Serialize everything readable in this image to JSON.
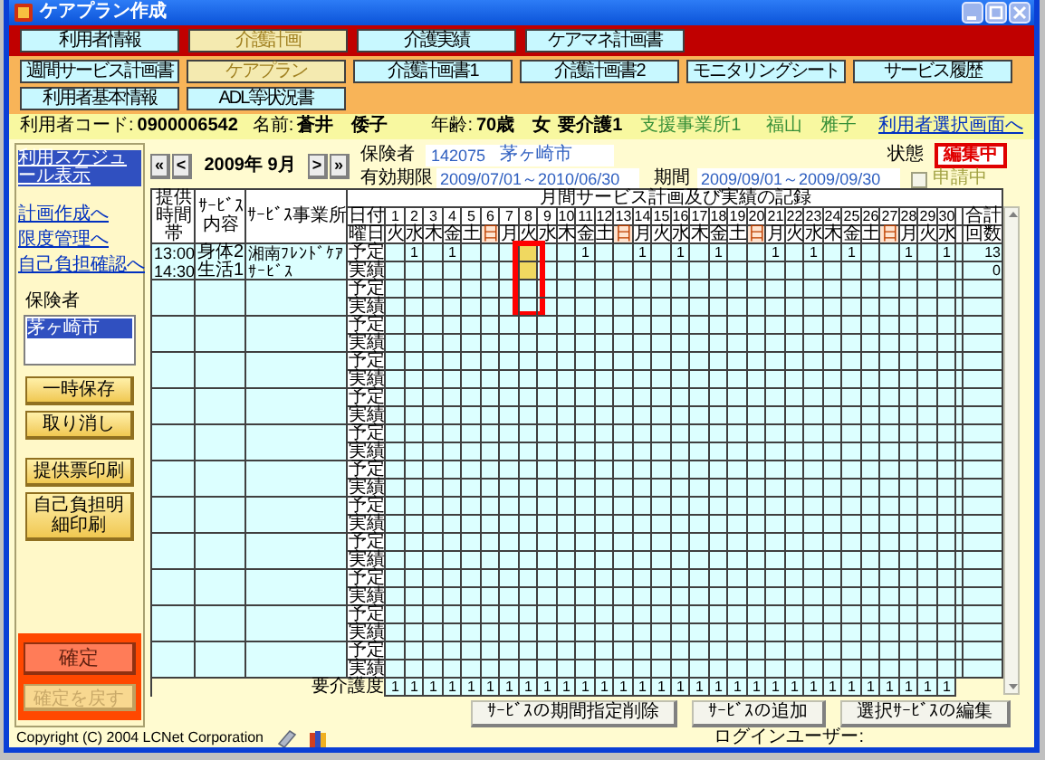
{
  "window": {
    "title": "ケアプラン作成"
  },
  "main_tabs": [
    {
      "label": "利用者情報",
      "selected": false
    },
    {
      "label": "介護計画",
      "selected": true
    },
    {
      "label": "介護実績",
      "selected": false
    },
    {
      "label": "ケアマネ計画書",
      "selected": false
    }
  ],
  "sub_tabs": [
    {
      "label": "週間サービス計画書",
      "selected": false
    },
    {
      "label": "ケアプラン",
      "selected": true
    },
    {
      "label": "介護計画書1",
      "selected": false
    },
    {
      "label": "介護計画書2",
      "selected": false
    },
    {
      "label": "モニタリングシート",
      "selected": false
    },
    {
      "label": "サービス履歴",
      "selected": false
    },
    {
      "label": "利用者基本情報",
      "selected": false
    },
    {
      "label": "ADL等状況書",
      "selected": false
    }
  ],
  "user_info": {
    "code_label": "利用者コード:",
    "code": "0900006542",
    "name_label": "名前:",
    "name": "蒼井　倭子",
    "age_label": "年齢:",
    "age": "70歳",
    "sex": "女",
    "care_level": "要介護1",
    "office": "支援事業所1",
    "manager": "福山　雅子",
    "select_link": "利用者選択画面へ"
  },
  "sidebar": {
    "schedule_link": {
      "label": "利用スケジュール表示",
      "selected": true
    },
    "links": [
      "計画作成へ",
      "限度管理へ",
      "自己負担確認へ"
    ],
    "insurer_label": "保険者",
    "insurers": [
      {
        "label": "茅ヶ崎市",
        "selected": true
      }
    ],
    "buttons": [
      "一時保存",
      "取り消し",
      "提供票印刷",
      "自己負担明細印刷"
    ],
    "confirm_button": {
      "label": "確定"
    },
    "undo_button": {
      "label": "確定を戻す",
      "disabled": true
    }
  },
  "month_nav": {
    "first": "«",
    "prev": "<",
    "month": "2009年 9月",
    "next": ">",
    "last": "»"
  },
  "insurer": {
    "label": "保険者",
    "number": "142075",
    "name": "茅ヶ崎市"
  },
  "status": {
    "label": "状態",
    "value": "編集中"
  },
  "validity": {
    "label": "有効期限",
    "value": "2009/07/01～2010/06/30"
  },
  "period": {
    "label": "期間",
    "value": "2009/09/01～2009/09/30"
  },
  "applying": {
    "label": "申請中",
    "checked": false
  },
  "schedule": {
    "title": "月間サービス計画及び実績の記録",
    "columns": [
      "提供時間帯",
      "ｻｰﾋﾞｽ内容",
      "ｻｰﾋﾞｽ事業所"
    ],
    "date_label": "日付",
    "weekday_label": "曜日",
    "total_labels": [
      "合計",
      "回数"
    ],
    "days": [
      {
        "date": "1",
        "weekday": "火",
        "holiday": false,
        "marked": false
      },
      {
        "date": "2",
        "weekday": "水",
        "holiday": false,
        "marked": false
      },
      {
        "date": "3",
        "weekday": "木",
        "holiday": false,
        "marked": false
      },
      {
        "date": "4",
        "weekday": "金",
        "holiday": false,
        "marked": false
      },
      {
        "date": "5",
        "weekday": "土",
        "holiday": false,
        "marked": false
      },
      {
        "date": "6",
        "weekday": "日",
        "holiday": true,
        "marked": false
      },
      {
        "date": "7",
        "weekday": "月",
        "holiday": false,
        "marked": false
      },
      {
        "date": "8",
        "weekday": "火",
        "holiday": false,
        "marked": true
      },
      {
        "date": "9",
        "weekday": "水",
        "holiday": false,
        "marked": false
      },
      {
        "date": "10",
        "weekday": "木",
        "holiday": false,
        "marked": false
      },
      {
        "date": "11",
        "weekday": "金",
        "holiday": false,
        "marked": false
      },
      {
        "date": "12",
        "weekday": "土",
        "holiday": false,
        "marked": false
      },
      {
        "date": "13",
        "weekday": "日",
        "holiday": true,
        "marked": false
      },
      {
        "date": "14",
        "weekday": "月",
        "holiday": false,
        "marked": false
      },
      {
        "date": "15",
        "weekday": "火",
        "holiday": false,
        "marked": false
      },
      {
        "date": "16",
        "weekday": "水",
        "holiday": false,
        "marked": false
      },
      {
        "date": "17",
        "weekday": "木",
        "holiday": false,
        "marked": false
      },
      {
        "date": "18",
        "weekday": "金",
        "holiday": false,
        "marked": false
      },
      {
        "date": "19",
        "weekday": "土",
        "holiday": false,
        "marked": false
      },
      {
        "date": "20",
        "weekday": "日",
        "holiday": true,
        "marked": false
      },
      {
        "date": "21",
        "weekday": "月",
        "holiday": false,
        "marked": false
      },
      {
        "date": "22",
        "weekday": "火",
        "holiday": false,
        "marked": false
      },
      {
        "date": "23",
        "weekday": "水",
        "holiday": false,
        "marked": false
      },
      {
        "date": "24",
        "weekday": "木",
        "holiday": false,
        "marked": false
      },
      {
        "date": "25",
        "weekday": "金",
        "holiday": false,
        "marked": false
      },
      {
        "date": "26",
        "weekday": "土",
        "holiday": false,
        "marked": false
      },
      {
        "date": "27",
        "weekday": "日",
        "holiday": true,
        "marked": false
      },
      {
        "date": "28",
        "weekday": "月",
        "holiday": false,
        "marked": false
      },
      {
        "date": "29",
        "weekday": "火",
        "holiday": false,
        "marked": false
      },
      {
        "date": "30",
        "weekday": "水",
        "holiday": false,
        "marked": false
      }
    ],
    "rows": [
      {
        "time": "13:00 14:30",
        "service": "身体2生活1",
        "provider": "湘南ﾌﾚﾝﾄﾞｹｱｻｰﾋﾞｽ",
        "plan_label": "予定",
        "actual_label": "実績",
        "plan": [
          {
            "highlighted": false
          },
          {
            "value": "1",
            "highlighted": false
          },
          {
            "highlighted": false
          },
          {
            "value": "1",
            "highlighted": false
          },
          {
            "highlighted": false
          },
          {
            "highlighted": false
          },
          {
            "highlighted": false
          },
          {
            "highlighted": true
          },
          {
            "highlighted": false
          },
          {
            "highlighted": false
          },
          {
            "value": "1",
            "highlighted": false
          },
          {
            "highlighted": false
          },
          {
            "highlighted": false
          },
          {
            "value": "1",
            "highlighted": false
          },
          {
            "highlighted": false
          },
          {
            "value": "1",
            "highlighted": false
          },
          {
            "highlighted": false
          },
          {
            "value": "1",
            "highlighted": false
          },
          {
            "highlighted": false
          },
          {
            "highlighted": false
          },
          {
            "value": "1",
            "highlighted": false
          },
          {
            "highlighted": false
          },
          {
            "value": "1",
            "highlighted": false
          },
          {
            "highlighted": false
          },
          {
            "value": "1",
            "highlighted": false
          },
          {
            "highlighted": false
          },
          {
            "highlighted": false
          },
          {
            "value": "1",
            "highlighted": false
          },
          {
            "highlighted": false
          },
          {
            "value": "1",
            "highlighted": false
          }
        ],
        "actual": [
          {
            "highlighted": false
          },
          {
            "highlighted": false
          },
          {
            "highlighted": false
          },
          {
            "highlighted": false
          },
          {
            "highlighted": false
          },
          {
            "highlighted": false
          },
          {
            "highlighted": false
          },
          {
            "highlighted": true
          },
          {
            "highlighted": false
          },
          {
            "highlighted": false
          },
          {
            "highlighted": false
          },
          {
            "highlighted": false
          },
          {
            "highlighted": false
          },
          {
            "highlighted": false
          },
          {
            "highlighted": false
          },
          {
            "highlighted": false
          },
          {
            "highlighted": false
          },
          {
            "highlighted": false
          },
          {
            "highlighted": false
          },
          {
            "highlighted": false
          },
          {
            "highlighted": false
          },
          {
            "highlighted": false
          },
          {
            "highlighted": false
          },
          {
            "highlighted": false
          },
          {
            "highlighted": false
          },
          {
            "highlighted": false
          },
          {
            "highlighted": false
          },
          {
            "highlighted": false
          },
          {
            "highlighted": false
          },
          {
            "highlighted": false
          }
        ],
        "plan_total": "13",
        "actual_total": "0"
      },
      {
        "plan_label": "予定",
        "actual_label": "実績"
      },
      {
        "plan_label": "予定",
        "actual_label": "実績"
      },
      {
        "plan_label": "予定",
        "actual_label": "実績"
      },
      {
        "plan_label": "予定",
        "actual_label": "実績"
      },
      {
        "plan_label": "予定",
        "actual_label": "実績"
      },
      {
        "plan_label": "予定",
        "actual_label": "実績"
      },
      {
        "plan_label": "予定",
        "actual_label": "実績"
      },
      {
        "plan_label": "予定",
        "actual_label": "実績"
      },
      {
        "plan_label": "予定",
        "actual_label": "実績"
      },
      {
        "plan_label": "予定",
        "actual_label": "実績"
      },
      {
        "plan_label": "予定",
        "actual_label": "実績"
      }
    ],
    "care_level_label": "要介護度",
    "care_levels": [
      "1",
      "1",
      "1",
      "1",
      "1",
      "1",
      "1",
      "1",
      "1",
      "1",
      "1",
      "1",
      "1",
      "1",
      "1",
      "1",
      "1",
      "1",
      "1",
      "1",
      "1",
      "1",
      "1",
      "1",
      "1",
      "1",
      "1",
      "1",
      "1",
      "1"
    ]
  },
  "actions": [
    "ｻｰﾋﾞｽの期間指定削除",
    "ｻｰﾋﾞｽの追加",
    "選択ｻｰﾋﾞｽの編集"
  ],
  "footer": {
    "copyright": "Copyright (C) 2004 LCNet Corporation",
    "login_label": "ログインユーザー:"
  }
}
